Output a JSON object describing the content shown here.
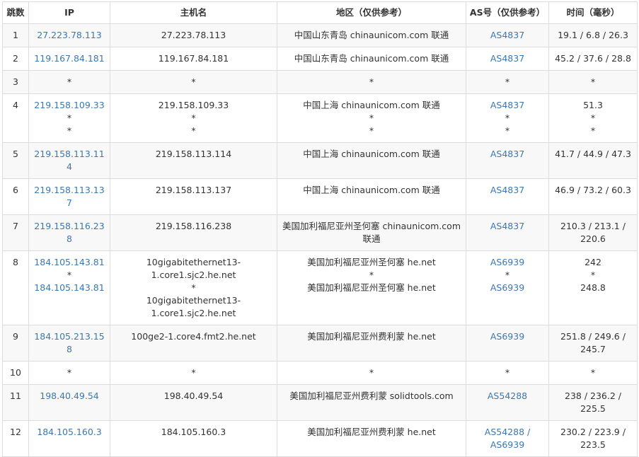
{
  "headers": {
    "hop": "跳数",
    "ip": "IP",
    "host": "主机名",
    "loc": "地区（仅供参考）",
    "as": "AS号（仅供参考）",
    "time": "时间（毫秒）"
  },
  "rows": [
    {
      "hop": "1",
      "ip": [
        "27.223.78.113"
      ],
      "host": [
        "27.223.78.113"
      ],
      "loc": [
        "中国山东青岛 chinaunicom.com 联通"
      ],
      "as": [
        "AS4837"
      ],
      "time": [
        "19.1 / 6.8 / 26.3"
      ]
    },
    {
      "hop": "2",
      "ip": [
        "119.167.84.181"
      ],
      "host": [
        "119.167.84.181"
      ],
      "loc": [
        "中国山东青岛 chinaunicom.com 联通"
      ],
      "as": [
        "AS4837"
      ],
      "time": [
        "45.2 / 37.6 / 28.8"
      ]
    },
    {
      "hop": "3",
      "ip": [
        "*"
      ],
      "host": [
        "*"
      ],
      "loc": [
        "*"
      ],
      "as": [
        "*"
      ],
      "time": [
        "*"
      ]
    },
    {
      "hop": "4",
      "ip": [
        "219.158.109.33",
        "*",
        "*"
      ],
      "host": [
        "219.158.109.33",
        "*",
        "*"
      ],
      "loc": [
        "中国上海 chinaunicom.com 联通",
        "*",
        "*"
      ],
      "as": [
        "AS4837",
        "*",
        "*"
      ],
      "time": [
        "51.3",
        "*",
        "*"
      ]
    },
    {
      "hop": "5",
      "ip": [
        "219.158.113.114"
      ],
      "host": [
        "219.158.113.114"
      ],
      "loc": [
        "中国上海 chinaunicom.com 联通"
      ],
      "as": [
        "AS4837"
      ],
      "time": [
        "41.7 / 44.9 / 47.3"
      ]
    },
    {
      "hop": "6",
      "ip": [
        "219.158.113.137"
      ],
      "host": [
        "219.158.113.137"
      ],
      "loc": [
        "中国上海 chinaunicom.com 联通"
      ],
      "as": [
        "AS4837"
      ],
      "time": [
        "46.9 / 73.2 / 60.3"
      ]
    },
    {
      "hop": "7",
      "ip": [
        "219.158.116.238"
      ],
      "host": [
        "219.158.116.238"
      ],
      "loc": [
        "美国加利福尼亚州圣何塞 chinaunicom.com 联通"
      ],
      "as": [
        "AS4837"
      ],
      "time": [
        "210.3 / 213.1 / 220.6"
      ]
    },
    {
      "hop": "8",
      "ip": [
        "184.105.143.81",
        "*",
        "184.105.143.81"
      ],
      "host": [
        "10gigabitethernet13-1.core1.sjc2.he.net",
        "*",
        "10gigabitethernet13-1.core1.sjc2.he.net"
      ],
      "loc": [
        "美国加利福尼亚州圣何塞 he.net",
        "*",
        "美国加利福尼亚州圣何塞 he.net"
      ],
      "as": [
        "AS6939",
        "*",
        "AS6939"
      ],
      "time": [
        "242",
        "*",
        "248.8"
      ]
    },
    {
      "hop": "9",
      "ip": [
        "184.105.213.158"
      ],
      "host": [
        "100ge2-1.core4.fmt2.he.net"
      ],
      "loc": [
        "美国加利福尼亚州费利蒙 he.net"
      ],
      "as": [
        "AS6939"
      ],
      "time": [
        "251.8 / 249.6 / 245.7"
      ]
    },
    {
      "hop": "10",
      "ip": [
        "*"
      ],
      "host": [
        "*"
      ],
      "loc": [
        "*"
      ],
      "as": [
        "*"
      ],
      "time": [
        "*"
      ]
    },
    {
      "hop": "11",
      "ip": [
        "198.40.49.54"
      ],
      "host": [
        "198.40.49.54"
      ],
      "loc": [
        "美国加利福尼亚州费利蒙 solidtools.com"
      ],
      "as": [
        "AS54288"
      ],
      "time": [
        "238 / 236.2 / 225.5"
      ]
    },
    {
      "hop": "12",
      "ip": [
        "184.105.160.3"
      ],
      "host": [
        "184.105.160.3"
      ],
      "loc": [
        "美国加利福尼亚州费利蒙 he.net"
      ],
      "as": [
        "AS54288 / AS6939"
      ],
      "time": [
        "230.2 / 223.9 / 223.5"
      ]
    }
  ]
}
